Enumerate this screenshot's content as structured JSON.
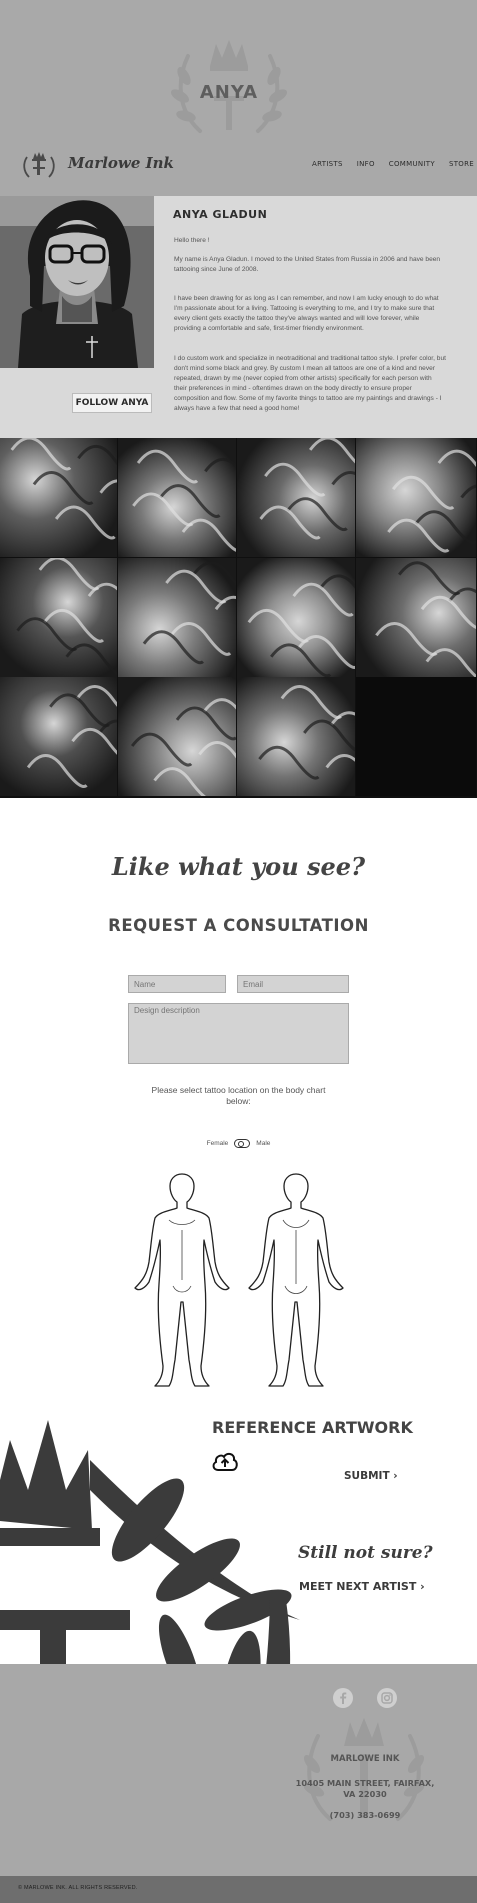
{
  "header": {
    "crest_text": "ANYA",
    "brand": "Marlowe Ink",
    "nav": [
      "ARTISTS",
      "INFO",
      "COMMUNITY",
      "STORE"
    ]
  },
  "bio": {
    "name": "ANYA GLADUN",
    "follow_label": "FOLLOW ANYA",
    "paragraphs": [
      "Hello there !",
      "My name is Anya Gladun. I moved to the United States from Russia in 2006 and have been tattooing since June of 2008.",
      "I have been drawing for as long as I can remember, and now I am lucky enough to do what I'm passionate about for a living. Tattooing is everything to me, and I try to make sure that every client gets exactly the tattoo they've always wanted and will love forever, while providing a comfortable and safe, first-timer friendly environment.",
      "I do custom work and specialize in neotraditional and traditional tattoo style. I prefer color, but don't mind some black and grey. By custom I mean all tattoos are one of a kind and never repeated, drawn by me (never copied from other artists) specifically for each person with their preferences in mind - oftentimes drawn on the body directly to ensure proper composition and flow.  Some of my favorite things to tattoo are my paintings and drawings - I always have a few that need a good home!"
    ]
  },
  "consultation": {
    "like_title": "Like what you see?",
    "title": "REQUEST A CONSULTATION",
    "name_placeholder": "Name",
    "email_placeholder": "Email",
    "description_placeholder": "Design description",
    "select_text": "Please select tattoo location on the body chart below:",
    "female_label": "Female",
    "male_label": "Male"
  },
  "reference": {
    "title": "REFERENCE ARTWORK",
    "submit_label": "SUBMIT ›",
    "still_title": "Still not sure?",
    "meet_next": "MEET NEXT ARTIST ›"
  },
  "footer": {
    "name": "MARLOWE INK",
    "address": "10405 MAIN STREET, FAIRFAX, VA 22030",
    "phone": "(703) 383-0699",
    "copyright": "© MARLOWE INK.  ALL RIGHTS RESERVED."
  }
}
